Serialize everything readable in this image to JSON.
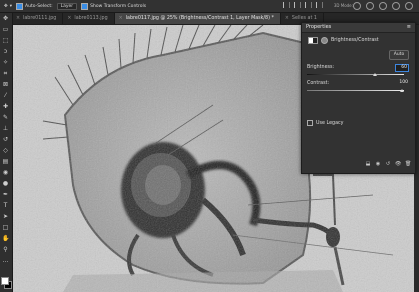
{
  "options_bar": {
    "auto_select_label": "Auto-Select:",
    "auto_select_value": "Layer",
    "show_transform_label": "Show Transform Controls",
    "mode_3d_label": "3D Mode:"
  },
  "tabs": [
    {
      "label": "labre0111.jpg",
      "active": false
    },
    {
      "label": "labre0113.jpg",
      "active": false
    },
    {
      "label": "labre0117.jpg @ 25% (Brightness/Contrast 1, Layer Mask/8) *",
      "active": true
    },
    {
      "label": "Selles at 1",
      "active": false
    }
  ],
  "tools": [
    "move-tool",
    "artboard-tool",
    "marquee-tool",
    "lasso-tool",
    "magic-wand-tool",
    "crop-tool",
    "frame-tool",
    "eyedropper-tool",
    "spot-healing-tool",
    "brush-tool",
    "clone-stamp-tool",
    "history-brush-tool",
    "eraser-tool",
    "gradient-tool",
    "blur-tool",
    "dodge-tool",
    "pen-tool",
    "type-tool",
    "path-selection-tool",
    "rectangle-tool",
    "hand-tool",
    "zoom-tool",
    "more-tools"
  ],
  "properties": {
    "title": "Properties",
    "adjustment": "Brightness/Contrast",
    "auto_label": "Auto",
    "brightness_label": "Brightness:",
    "brightness_value": "60",
    "brightness_fraction": 0.7,
    "contrast_label": "Contrast:",
    "contrast_value": "100",
    "contrast_fraction": 0.98,
    "legacy_label": "Use Legacy"
  },
  "colors": {
    "panel_bg": "#323232",
    "accent": "#3d86e0",
    "canvas_bg": "#c9c9c9"
  }
}
